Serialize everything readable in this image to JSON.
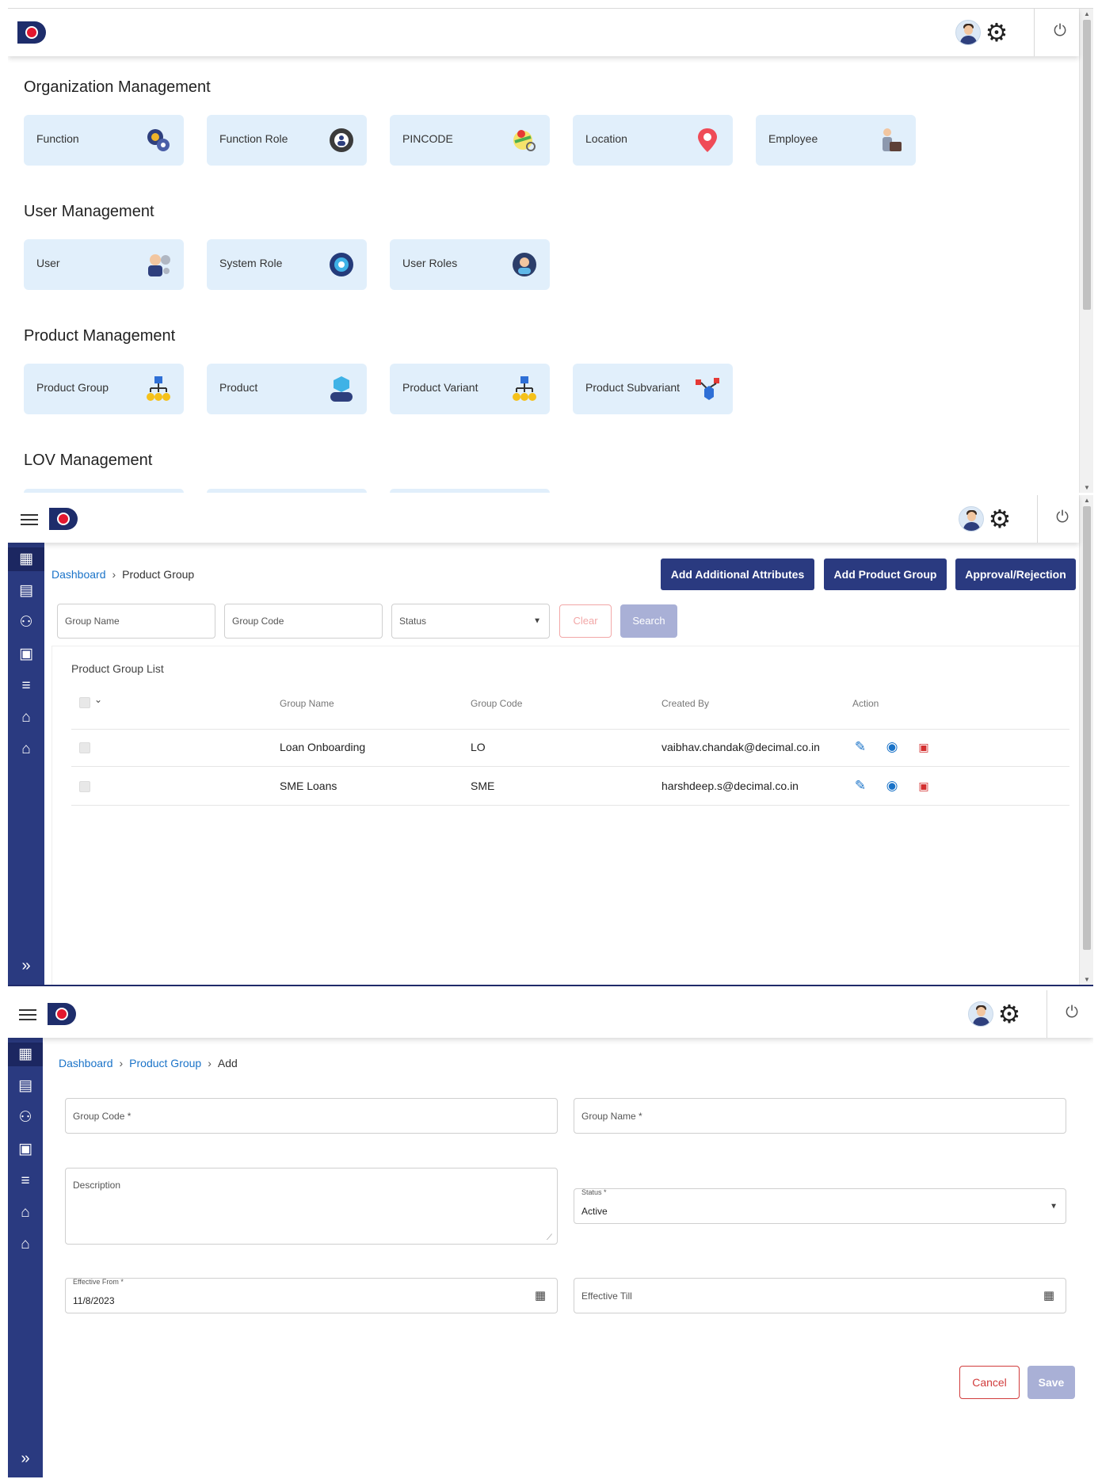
{
  "screen1": {
    "sections": [
      {
        "title": "Organization Management",
        "tiles": [
          {
            "label": "Function",
            "icon": "function-gear-icon"
          },
          {
            "label": "Function Role",
            "icon": "function-role-gear-icon"
          },
          {
            "label": "PINCODE",
            "icon": "pincode-map-icon"
          },
          {
            "label": "Location",
            "icon": "location-pin-icon"
          },
          {
            "label": "Employee",
            "icon": "employee-briefcase-icon"
          }
        ]
      },
      {
        "title": "User Management",
        "tiles": [
          {
            "label": "User",
            "icon": "user-settings-icon"
          },
          {
            "label": "System Role",
            "icon": "system-role-gear-icon"
          },
          {
            "label": "User Roles",
            "icon": "user-roles-icon"
          }
        ]
      },
      {
        "title": "Product Management",
        "tiles": [
          {
            "label": "Product Group",
            "icon": "product-group-hierarchy-icon"
          },
          {
            "label": "Product",
            "icon": "product-box-icon"
          },
          {
            "label": "Product Variant",
            "icon": "product-variant-hierarchy-icon"
          },
          {
            "label": "Product Subvariant",
            "icon": "product-subvariant-icon"
          }
        ]
      },
      {
        "title": "LOV Management",
        "tiles": []
      }
    ]
  },
  "screen2": {
    "breadcrumb": {
      "root": "Dashboard",
      "current": "Product Group"
    },
    "buttons": {
      "add_attributes": "Add Additional Attributes",
      "add_group": "Add Product Group",
      "approval": "Approval/Rejection"
    },
    "filters": {
      "group_name_placeholder": "Group Name",
      "group_code_placeholder": "Group Code",
      "status_placeholder": "Status",
      "clear": "Clear",
      "search": "Search"
    },
    "list": {
      "title": "Product Group List",
      "headers": [
        "Group Name",
        "Group Code",
        "Created By",
        "Action"
      ],
      "rows": [
        {
          "name": "Loan Onboarding",
          "code": "LO",
          "created_by": "vaibhav.chandak@decimal.co.in"
        },
        {
          "name": "SME Loans",
          "code": "SME",
          "created_by": "harshdeep.s@decimal.co.in"
        }
      ]
    }
  },
  "screen3": {
    "breadcrumb": {
      "root": "Dashboard",
      "parent": "Product Group",
      "current": "Add"
    },
    "form": {
      "group_code_label": "Group Code *",
      "group_name_label": "Group Name *",
      "description_label": "Description",
      "status_label": "Status *",
      "status_value": "Active",
      "effective_from_label": "Effective From *",
      "effective_from_value": "11/8/2023",
      "effective_till_label": "Effective Till",
      "cancel": "Cancel",
      "save": "Save"
    }
  },
  "colors": {
    "navy": "#2a3a80",
    "link": "#1a73c8",
    "tile": "#e1effb",
    "danger": "#d13c3c"
  }
}
